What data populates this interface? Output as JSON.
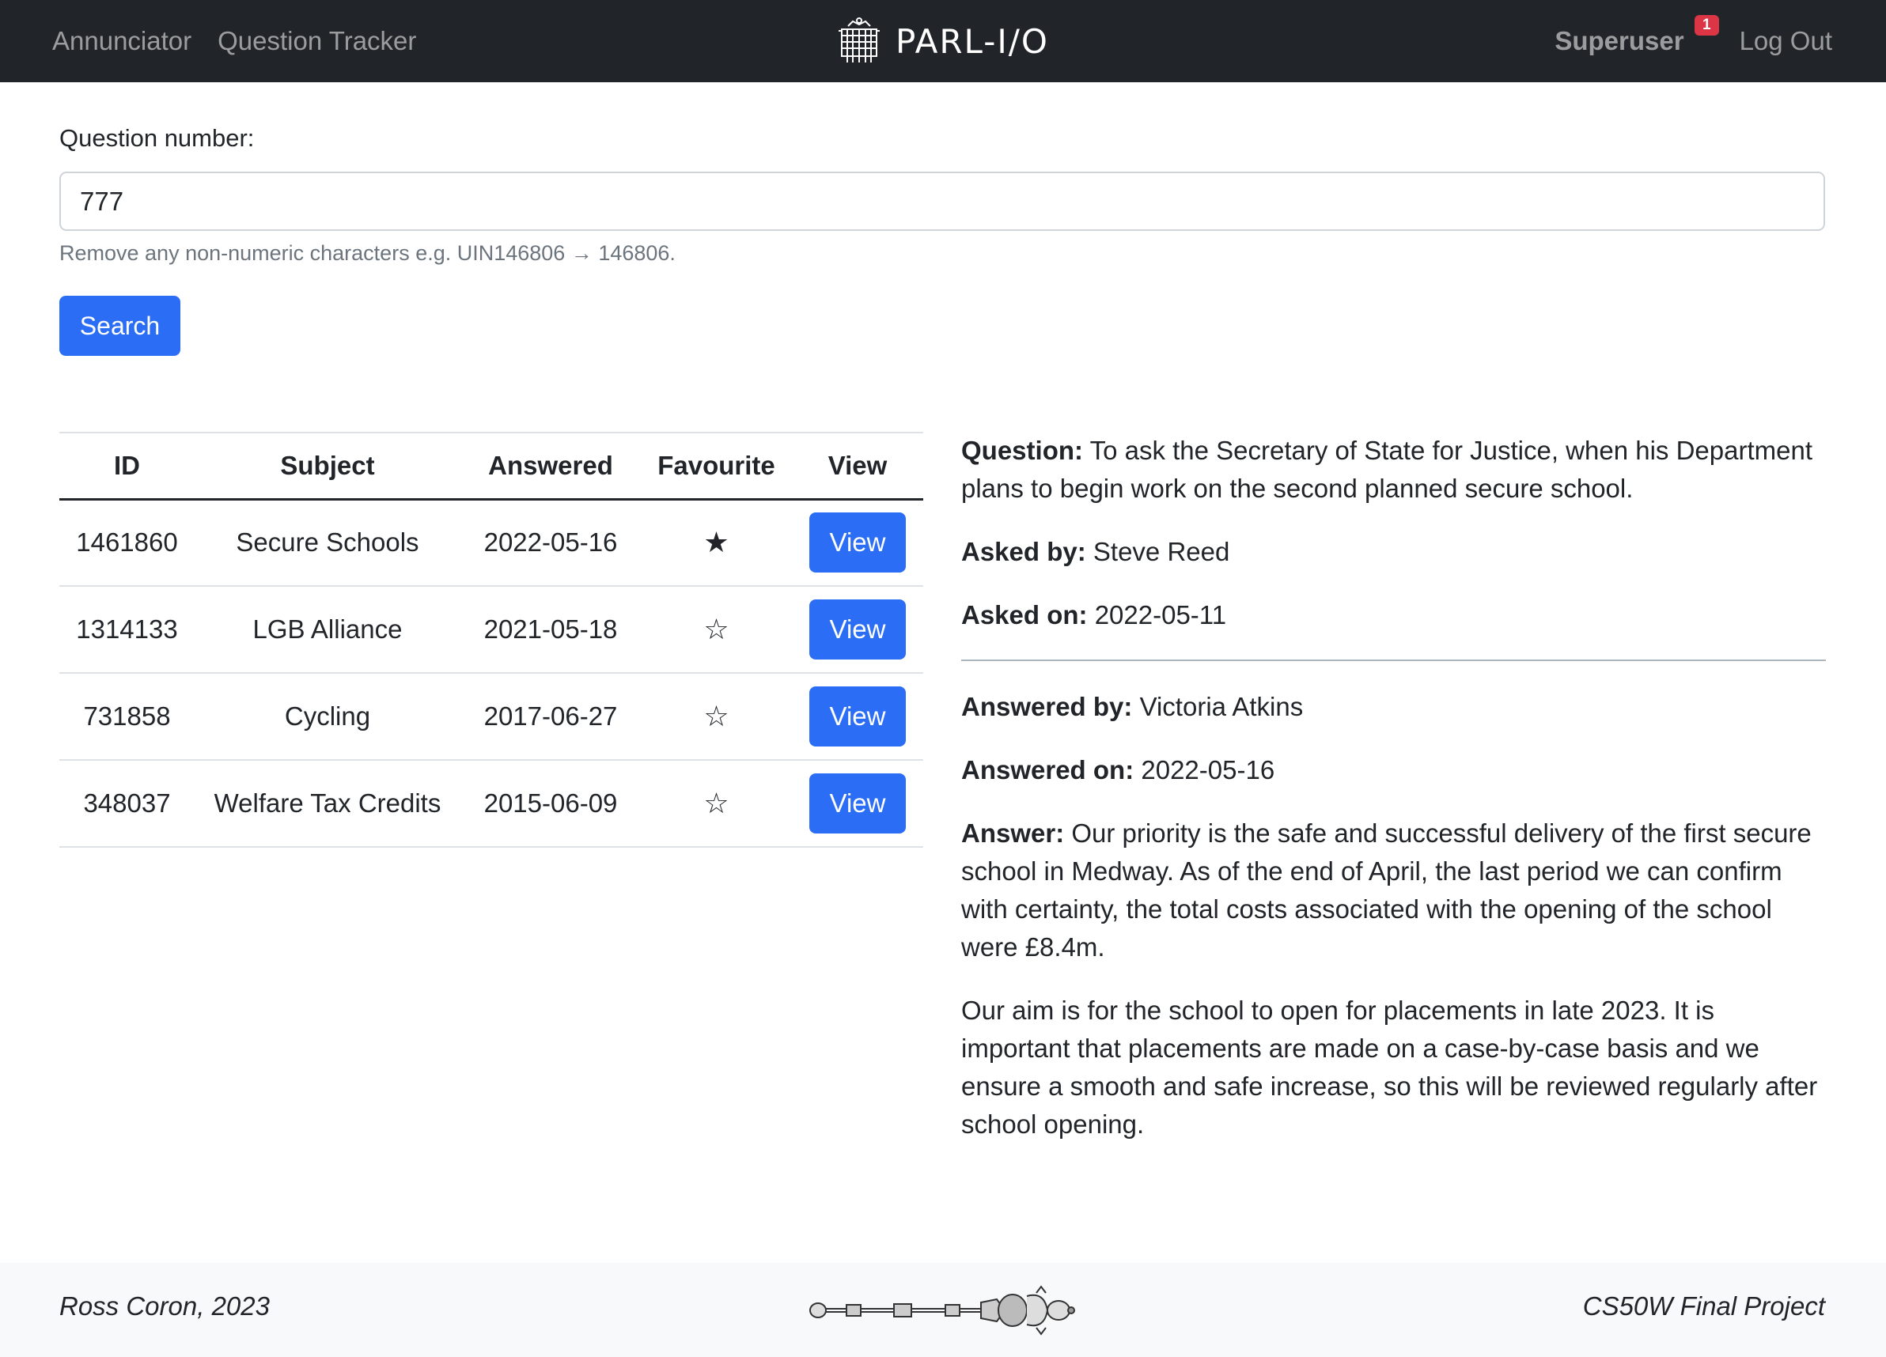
{
  "nav": {
    "links": [
      "Annunciator",
      "Question Tracker"
    ],
    "brand": "PARL-I/O",
    "user": "Superuser",
    "badge_count": "1",
    "logout": "Log Out"
  },
  "form": {
    "label": "Question number:",
    "value": "777",
    "help": "Remove any non-numeric characters e.g. UIN146806 → 146806.",
    "search_label": "Search"
  },
  "table": {
    "headers": [
      "ID",
      "Subject",
      "Answered",
      "Favourite",
      "View"
    ],
    "rows": [
      {
        "id": "1461860",
        "subject": "Secure Schools",
        "answered": "2022-05-16",
        "favourite": "★",
        "view": "View"
      },
      {
        "id": "1314133",
        "subject": "LGB Alliance",
        "answered": "2021-05-18",
        "favourite": "☆",
        "view": "View"
      },
      {
        "id": "731858",
        "subject": "Cycling",
        "answered": "2017-06-27",
        "favourite": "☆",
        "view": "View"
      },
      {
        "id": "348037",
        "subject": "Welfare Tax Credits",
        "answered": "2015-06-09",
        "favourite": "☆",
        "view": "View"
      }
    ]
  },
  "detail": {
    "question_label": "Question:",
    "question": "To ask the Secretary of State for Justice, when his Department plans to begin work on the second planned secure school.",
    "asked_by_label": "Asked by:",
    "asked_by": "Steve Reed",
    "asked_on_label": "Asked on:",
    "asked_on": "2022-05-11",
    "answered_by_label": "Answered by:",
    "answered_by": "Victoria Atkins",
    "answered_on_label": "Answered on:",
    "answered_on": "2022-05-16",
    "answer_label": "Answer:",
    "answer_p1": "Our priority is the safe and successful delivery of the first secure school in Medway. As of the end of April, the last period we can confirm with certainty, the total costs associated with the opening of the school were £8.4m.",
    "answer_p2": "Our aim is for the school to open for placements in late 2023. It is important that placements are made on a case-by-case basis and we ensure a smooth and safe increase, so this will be reviewed regularly after school opening."
  },
  "footer": {
    "left": "Ross Coron, 2023",
    "right": "CS50W Final Project",
    "mace_icon": "ceremonial-mace-icon"
  }
}
